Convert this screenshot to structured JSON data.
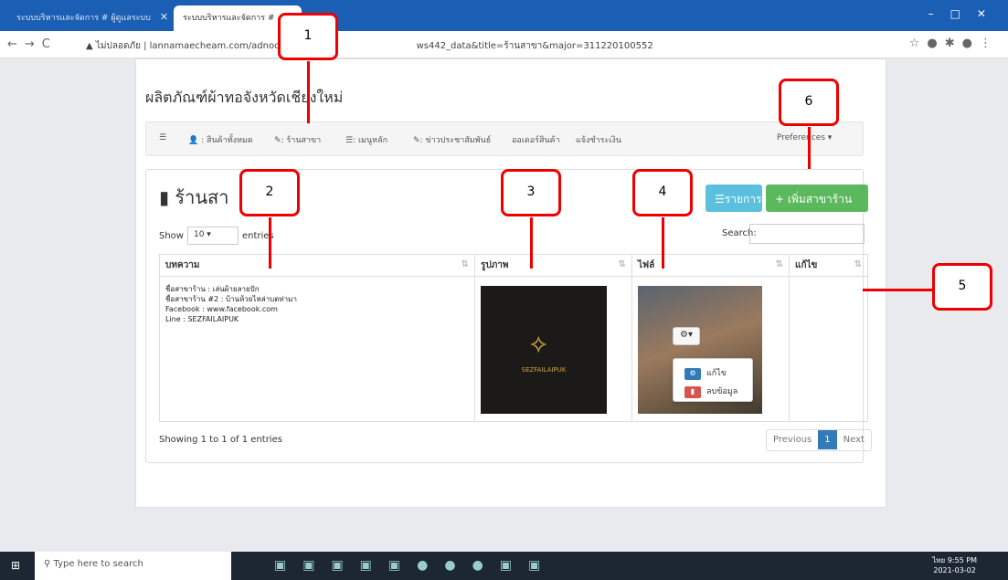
{
  "browser": {
    "tabs": [
      {
        "label": "ระบบบริหารและจัดการ # ผู้ดูแลระบบ"
      },
      {
        "label": "ระบบบริหารและจัดการ #"
      }
    ],
    "url_prefix": "ไม่ปลอดภัย | lannamaecheam.com/adnoc",
    "url_suffix": "ws442_data&title=ร้านสาขา&major=311220100552"
  },
  "site": {
    "title": "ผลิตภัณฑ์ผ้าทอจังหวัดเชียงใหม่"
  },
  "menu": {
    "items": [
      {
        "icon": "☰",
        "label": ""
      },
      {
        "icon": "👤",
        "label": ": สินค้าทั้งหมด"
      },
      {
        "icon": "✎",
        "label": ": ร้านสาขา"
      },
      {
        "icon": "☰",
        "label": ": เมนูหลัก"
      },
      {
        "icon": "✎",
        "label": ": ข่าวประชาสัมพันธ์"
      },
      {
        "icon": "",
        "label": "ออเดอร์สินค้า"
      },
      {
        "icon": "",
        "label": "แจ้งชำระเงิน"
      }
    ],
    "preferences": "Preferences ▾"
  },
  "panel": {
    "title": "ร้านสา",
    "list_button": "รายการ",
    "add_button": "+ เพิ่มสาขาร้าน",
    "show_label": "Show",
    "show_value": "10",
    "entries_label": "entries",
    "search_label": "Search:",
    "columns": [
      "บทความ",
      "รูปภาพ",
      "ไฟล์",
      "แก้ไข"
    ],
    "row": {
      "lines": [
        "ชื่อสาขาร้าน : เล่นผ้ายลายปัก",
        "ชื่อสาขาร้าน #2 : บ้านห้วยไหล่าบดท่ามา",
        "Facebook : www.facebook.com",
        "Line : SEZFAILAIPUK"
      ],
      "logo_text": "SEZFAILAIPUK"
    },
    "actions": {
      "edit": "แก้ไข",
      "delete": "ลบข้อมูล"
    },
    "showing": "Showing 1 to 1 of 1 entries",
    "pager": {
      "prev": "Previous",
      "current": "1",
      "next": "Next"
    }
  },
  "callouts": [
    "1",
    "2",
    "3",
    "4",
    "5",
    "6"
  ],
  "taskbar": {
    "search": "Type here to search",
    "time": "9:55 PM",
    "date": "2021-03-02",
    "lang": "ไทย"
  }
}
